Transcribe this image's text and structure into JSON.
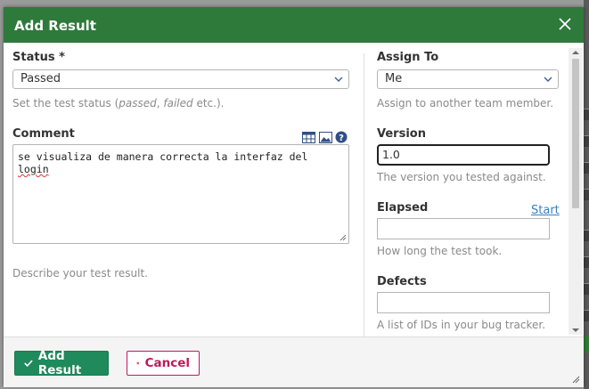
{
  "dialog": {
    "title": "Add Result",
    "close_icon": "close-icon"
  },
  "status": {
    "label": "Status *",
    "value": "Passed",
    "hint_prefix": "Set the test status (",
    "hint_passed": "passed",
    "hint_sep": ", ",
    "hint_failed": "failed",
    "hint_suffix": " etc.)."
  },
  "comment": {
    "label": "Comment",
    "text_main": "se visualiza de manera correcta la interfaz del ",
    "text_misspelled": "login",
    "hint": "Describe your test result.",
    "toolbar_icons": [
      "table-icon",
      "image-icon",
      "help-icon"
    ]
  },
  "assign_to": {
    "label": "Assign To",
    "value": "Me",
    "hint": "Assign to another team member."
  },
  "version": {
    "label": "Version",
    "value": "1.0",
    "hint": "The version you tested against."
  },
  "elapsed": {
    "label": "Elapsed",
    "start_link": "Start",
    "value": "",
    "hint": "How long the test took."
  },
  "defects": {
    "label": "Defects",
    "value": "",
    "hint": "A list of IDs in your bug tracker."
  },
  "footer": {
    "add_label": "Add Result",
    "cancel_label": "Cancel"
  },
  "colors": {
    "title_bar": "#2d7a3a",
    "primary_button": "#1f8a5c",
    "cancel_accent": "#c2185b",
    "link": "#3a7fc4"
  }
}
